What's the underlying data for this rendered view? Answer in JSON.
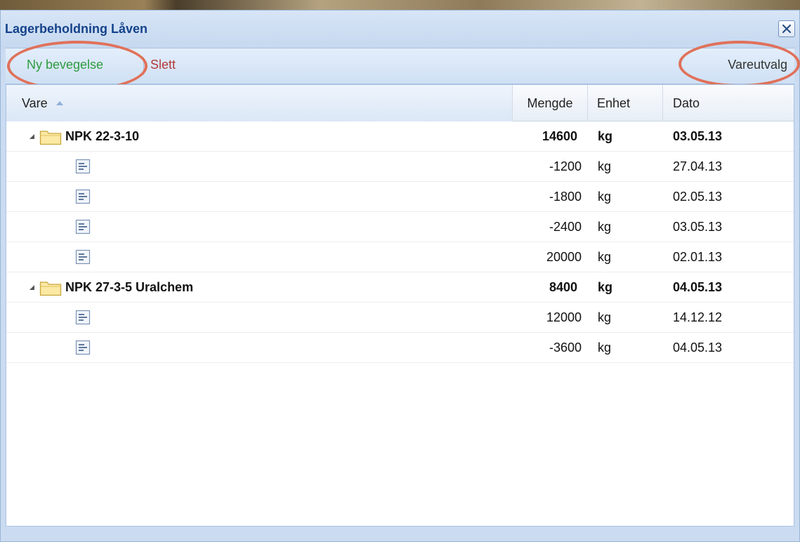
{
  "window": {
    "title": "Lagerbeholdning Låven"
  },
  "toolbar": {
    "new_label": "Ny bevegelse",
    "delete_label": "Slett",
    "filter_label": "Vareutvalg"
  },
  "grid": {
    "columns": {
      "vare": "Vare",
      "mengde": "Mengde",
      "enhet": "Enhet",
      "dato": "Dato"
    },
    "groups": [
      {
        "name": "NPK 22-3-10",
        "mengde": "14600",
        "enhet": "kg",
        "dato": "03.05.13",
        "rows": [
          {
            "mengde": "-1200",
            "enhet": "kg",
            "dato": "27.04.13"
          },
          {
            "mengde": "-1800",
            "enhet": "kg",
            "dato": "02.05.13"
          },
          {
            "mengde": "-2400",
            "enhet": "kg",
            "dato": "03.05.13"
          },
          {
            "mengde": "20000",
            "enhet": "kg",
            "dato": "02.01.13"
          }
        ]
      },
      {
        "name": "NPK 27-3-5 Uralchem",
        "mengde": "8400",
        "enhet": "kg",
        "dato": "04.05.13",
        "rows": [
          {
            "mengde": "12000",
            "enhet": "kg",
            "dato": "14.12.12"
          },
          {
            "mengde": "-3600",
            "enhet": "kg",
            "dato": "04.05.13"
          }
        ]
      }
    ]
  },
  "colors": {
    "title_text": "#15428b",
    "new_button": "#2e9b3e",
    "delete_button": "#b43a3a",
    "highlight_oval": "#e0715a"
  },
  "icons": {
    "close": "close-icon",
    "sort": "sort-ascending-icon",
    "expander": "expanded-triangle-icon",
    "folder": "folder-icon",
    "leaf": "document-row-icon"
  }
}
